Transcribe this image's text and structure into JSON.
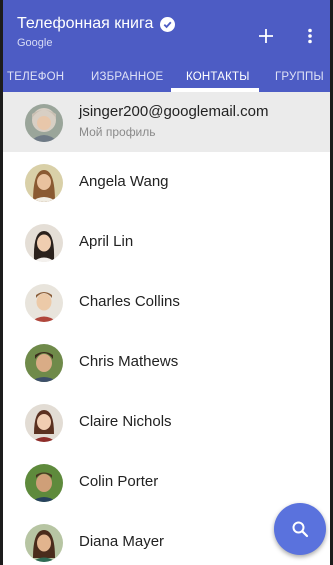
{
  "appbar": {
    "title": "Телефонная книга",
    "account": "Google",
    "icons": {
      "verified": "check-circle-icon",
      "add": "plus-icon",
      "more": "more-vert-icon"
    }
  },
  "tabs": [
    {
      "label": "ТЕЛЕФОН",
      "active": false
    },
    {
      "label": "ИЗБРАННОЕ",
      "active": false
    },
    {
      "label": "КОНТАКТЫ",
      "active": true
    },
    {
      "label": "ГРУППЫ",
      "active": false
    }
  ],
  "profile": {
    "email": "jsinger200@googlemail.com",
    "subtitle": "Мой профиль"
  },
  "contacts": [
    {
      "name": "Angela Wang"
    },
    {
      "name": "April Lin"
    },
    {
      "name": "Charles Collins"
    },
    {
      "name": "Chris Mathews"
    },
    {
      "name": "Claire Nichols"
    },
    {
      "name": "Colin Porter"
    },
    {
      "name": "Diana Mayer"
    }
  ],
  "fab": {
    "icon": "search-icon"
  },
  "colors": {
    "primary": "#4d5cc4",
    "fab": "#5a72dd",
    "profile_bg": "#ebebeb"
  }
}
